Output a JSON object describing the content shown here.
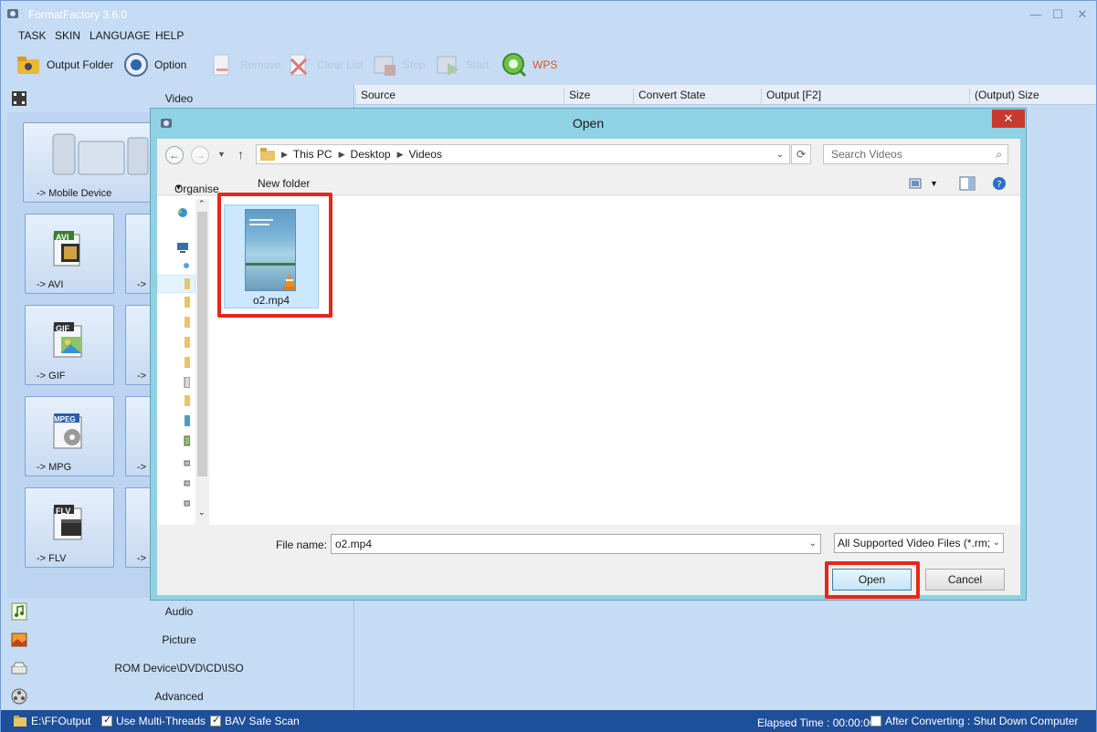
{
  "app": {
    "title": "FormatFactory 3.6.0",
    "window_controls": [
      "—",
      "☐",
      "✕"
    ]
  },
  "menu": [
    "TASK",
    "SKIN",
    "LANGUAGE",
    "HELP"
  ],
  "toolbar": {
    "output_folder": "Output Folder",
    "option": "Option",
    "remove": "Remove",
    "clear_list": "Clear List",
    "stop": "Stop",
    "start": "Start",
    "wps": "WPS"
  },
  "left_panel": {
    "video_section": "Video",
    "mobile_device": "-> Mobile Device",
    "tiles": [
      {
        "badge": "AVI",
        "label": "-> AVI"
      },
      {
        "badge": "GIF",
        "label": "-> GIF"
      },
      {
        "badge": "MPEG",
        "label": "-> MPG"
      },
      {
        "badge": "FLV",
        "label": "-> FLV"
      }
    ],
    "tiles_right_partial": [
      "->",
      "->",
      "->",
      "->"
    ],
    "audio_section": "Audio",
    "picture_section": "Picture",
    "rom_section": "ROM Device\\DVD\\CD\\ISO",
    "advanced_section": "Advanced"
  },
  "list_columns": [
    "Source",
    "Size",
    "Convert State",
    "Output [F2]",
    "(Output) Size"
  ],
  "statusbar": {
    "output_path": "E:\\FFOutput",
    "multi_threads": "Use Multi-Threads",
    "bav_scan": "BAV Safe Scan",
    "elapsed": "Elapsed Time : 00:00:00",
    "after_converting": "After Converting : Shut Down Computer"
  },
  "dialog": {
    "title": "Open",
    "close": "✕",
    "breadcrumb": [
      "This PC",
      "Desktop",
      "Videos"
    ],
    "search_placeholder": "Search Videos",
    "organise": "Organise",
    "new_folder": "New folder",
    "file": {
      "name": "o2.mp4"
    },
    "file_name_label": "File name:",
    "file_name_value": "o2.mp4",
    "filter": "All Supported Video Files (*.rm;",
    "open_button": "Open",
    "cancel_button": "Cancel"
  },
  "colors": {
    "highlight": "#e8261b",
    "dialog_frame": "#8fd2e3",
    "statusbar": "#1e4f9a",
    "app_bg": "#c6dcf5"
  }
}
